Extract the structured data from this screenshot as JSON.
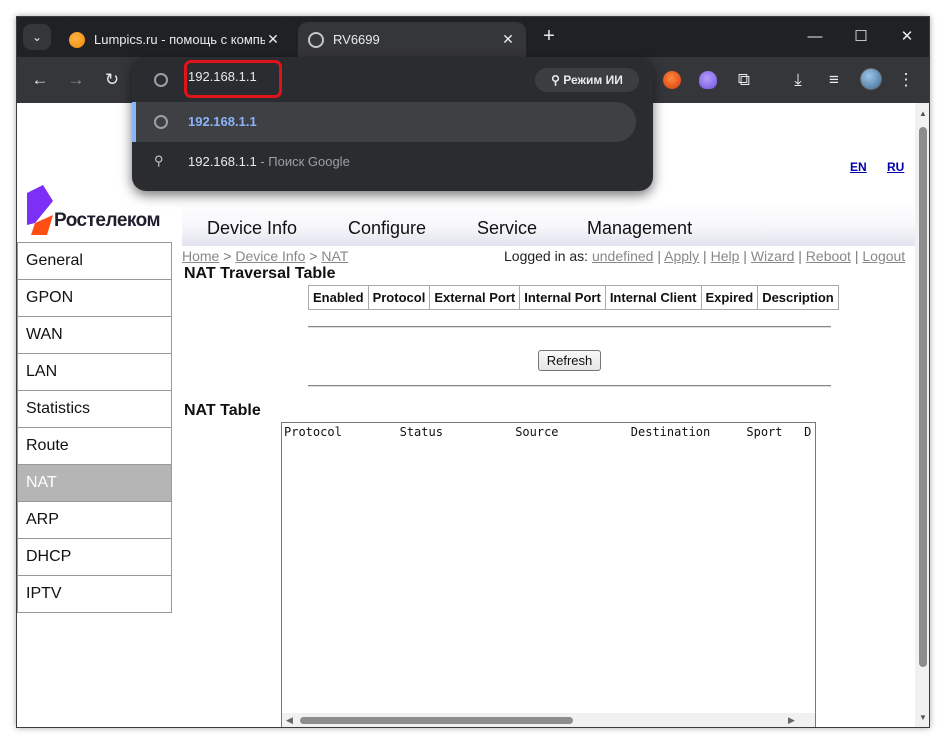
{
  "browser": {
    "tabs": [
      {
        "title": "Lumpics.ru - помощь с компьютером",
        "close": "✕"
      },
      {
        "title": "RV6699",
        "close": "✕"
      }
    ],
    "tab_search_icon": "⌄",
    "new_tab": "+",
    "window_controls": {
      "minimize": "—",
      "maximize": "☐",
      "close": "✕"
    },
    "nav": {
      "back": "←",
      "forward": "→",
      "reload": "↻"
    },
    "address": "192.168.1.1",
    "ai_mode_label": "⚲ Режим ИИ",
    "suggestions": [
      {
        "text": "192.168.1.1"
      },
      {
        "text": "192.168.1.1",
        "separator": " - ",
        "hint": "Поиск Google"
      }
    ],
    "toolbar_icons": {
      "download": "⤓",
      "menu": "⋮",
      "extensions": "⧉",
      "reading_list": "≡"
    },
    "colors": {
      "highlight": "#e0131b",
      "link_suggestion": "#8ab4f8",
      "chrome_dark": "#202124"
    }
  },
  "router": {
    "lang_en": "EN",
    "lang_ru": "RU",
    "brand": "Ростелеком",
    "topnav": [
      "Device Info",
      "Configure",
      "Service",
      "Management"
    ],
    "sidebar": [
      "General",
      "GPON",
      "WAN",
      "LAN",
      "Statistics",
      "Route",
      "NAT",
      "ARP",
      "DHCP",
      "IPTV"
    ],
    "active_sidebar": "NAT",
    "breadcrumb": {
      "home": "Home",
      "sep1": " > ",
      "device_info": "Device Info",
      "sep2": " > ",
      "nat": "NAT"
    },
    "userline": {
      "logged_in_as": "Logged in as: ",
      "user": "undefined",
      "apply": "Apply",
      "help": "Help",
      "wizard": "Wizard",
      "reboot": "Reboot",
      "logout": "Logout",
      "sep": " | "
    },
    "traversal_title": "NAT Traversal Table",
    "traversal_columns": [
      "Enabled",
      "Protocol",
      "External Port",
      "Internal Port",
      "Internal Client",
      "Expired",
      "Description"
    ],
    "refresh_label": "Refresh",
    "nat_table_title": "NAT Table",
    "nat_table_text": "Protocol        Status          Source          Destination     Sport   D",
    "colors": {
      "active_sidebar_bg": "#b5b5b5",
      "logo_purple": "#7b2ff7",
      "logo_orange": "#ff4f12"
    }
  }
}
